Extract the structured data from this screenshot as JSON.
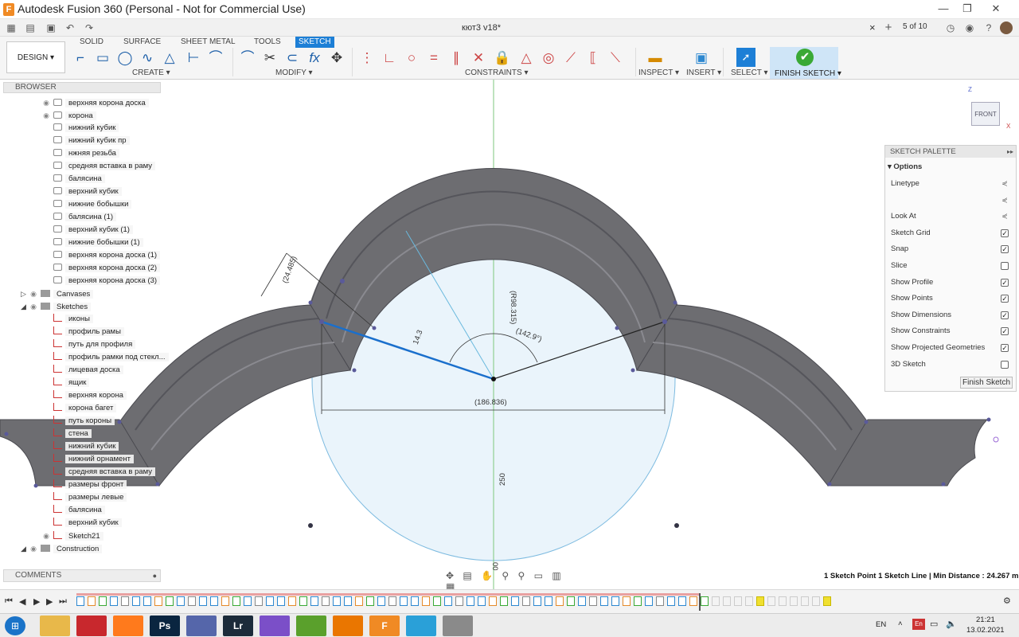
{
  "window": {
    "title": "Autodesk Fusion 360 (Personal - Not for Commercial Use)",
    "logo_letter": "F",
    "minimize": "—",
    "maximize": "❐",
    "close": "✕"
  },
  "app_header": {
    "document_tab": "кют3 v18*",
    "tab_close": "×",
    "new_tab": "+",
    "page_indicator": "5 of 10"
  },
  "ribbon": {
    "tabs": [
      "SOLID",
      "SURFACE",
      "SHEET METAL",
      "TOOLS",
      "SKETCH"
    ],
    "design_label": "DESIGN ▾",
    "groups": {
      "create": "CREATE ▾",
      "modify": "MODIFY ▾",
      "constraints": "CONSTRAINTS ▾",
      "inspect": "INSPECT ▾",
      "insert": "INSERT ▾",
      "select": "SELECT ▾",
      "finish": "FINISH SKETCH ▾"
    }
  },
  "browser": {
    "header": "BROWSER",
    "bodies": [
      "верхняя корона доска",
      "корона",
      "нижний кубик",
      "нижний кубик пр",
      "нжняя резьба",
      "средняя вставка в раму",
      "балясина",
      "верхний кубик",
      "нижние бобышки",
      "балясина (1)",
      "верхний кубик (1)",
      "нижние бобышки (1)",
      "верхняя корона доска (1)",
      "верхняя корона доска (2)",
      "верхняя корона доска (3)"
    ],
    "canvases": "Canvases",
    "sketches": "Sketches",
    "sketch_items": [
      "иконы",
      "профиль рамы",
      "путь для профиля",
      "профиль рамки под стекл...",
      "лицевая доска",
      "ящик",
      "верхняя корона",
      "корона багет",
      "путь короны",
      "стена",
      "нижний кубик",
      "нижний орнамент",
      "средняя вставка в раму",
      "размеры фронт",
      "размеры левые",
      "балясина",
      "верхний кубик",
      "Sketch21"
    ],
    "construction": "Construction"
  },
  "comments": {
    "label": "COMMENTS"
  },
  "sketch_palette": {
    "header": "SKETCH PALETTE",
    "section": "Options",
    "options": [
      {
        "label": "Linetype",
        "type": "icon"
      },
      {
        "label": "",
        "type": "icon"
      },
      {
        "label": "Look At",
        "type": "icon"
      },
      {
        "label": "Sketch Grid",
        "type": "check",
        "checked": true
      },
      {
        "label": "Snap",
        "type": "check",
        "checked": true
      },
      {
        "label": "Slice",
        "type": "check",
        "checked": false
      },
      {
        "label": "Show Profile",
        "type": "check",
        "checked": true
      },
      {
        "label": "Show Points",
        "type": "check",
        "checked": true
      },
      {
        "label": "Show Dimensions",
        "type": "check",
        "checked": true
      },
      {
        "label": "Show Constraints",
        "type": "check",
        "checked": true
      },
      {
        "label": "Show Projected Geometries",
        "type": "check",
        "checked": true
      },
      {
        "label": "3D Sketch",
        "type": "check",
        "checked": false
      }
    ],
    "finish_button": "Finish Sketch"
  },
  "viewcube": {
    "face": "FRONT",
    "axis_z": "Z",
    "axis_x": "X"
  },
  "dimensions": {
    "d1": "(24.485)",
    "d2": "(R98.315)",
    "d3": "(142.9°)",
    "d4": "14.3",
    "d5": "(186.836)",
    "d6": "250",
    "d7": "00"
  },
  "status": "1 Sketch Point 1 Sketch Line | Min Distance : 24.267 mm",
  "taskbar": {
    "lang": "EN",
    "time": "21:21",
    "date": "13.02.2021",
    "apps": [
      {
        "name": "file-explorer",
        "label": "",
        "color": "#e8b84a"
      },
      {
        "name": "app-red",
        "label": "",
        "color": "#c8282d"
      },
      {
        "name": "firefox",
        "label": "",
        "color": "#ff7a1c"
      },
      {
        "name": "photoshop",
        "label": "Ps",
        "color": "#0a2540"
      },
      {
        "name": "floppy",
        "label": "",
        "color": "#5566aa"
      },
      {
        "name": "lightroom",
        "label": "Lr",
        "color": "#1c2b3a"
      },
      {
        "name": "viber",
        "label": "",
        "color": "#7b4fc8"
      },
      {
        "name": "utorrent",
        "label": "",
        "color": "#5aa02c"
      },
      {
        "name": "blender",
        "label": "",
        "color": "#ea7600"
      },
      {
        "name": "fusion",
        "label": "F",
        "color": "#f08a24"
      },
      {
        "name": "telegram",
        "label": "",
        "color": "#2aa0d8"
      },
      {
        "name": "calculator",
        "label": "",
        "color": "#8a8a8a"
      }
    ]
  },
  "colors": {
    "accent": "#1d7fd6",
    "body_gray": "#6e6e72",
    "profile_blue": "#d9ebf7",
    "selected_line": "#1a6fcc"
  }
}
